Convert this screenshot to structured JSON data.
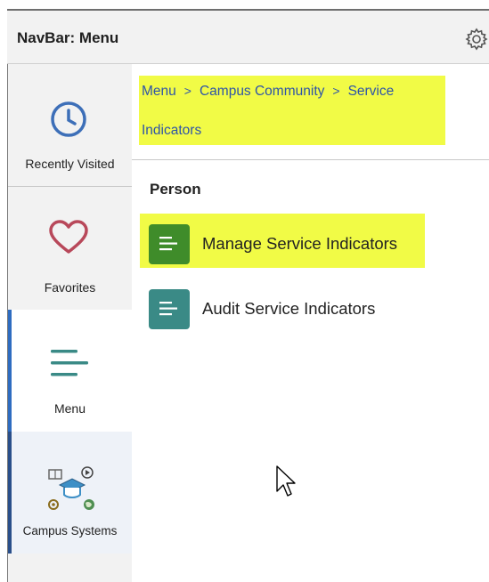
{
  "header": {
    "title": "NavBar: Menu",
    "gear_icon": "gear-icon"
  },
  "sidebar": {
    "items": [
      {
        "label": "Recently Visited",
        "icon": "clock-icon"
      },
      {
        "label": "Favorites",
        "icon": "heart-icon"
      },
      {
        "label": "Menu",
        "icon": "menu-icon"
      },
      {
        "label": "Campus Systems",
        "icon": "campus-systems-icon"
      }
    ]
  },
  "breadcrumb": {
    "items": [
      "Menu",
      "Campus Community",
      "Service",
      "Indicators"
    ],
    "separator": ">"
  },
  "section": {
    "title": "Person"
  },
  "menu_items": [
    {
      "label": "Manage Service Indicators",
      "icon": "list-icon",
      "color": "#3f8c2a"
    },
    {
      "label": "Audit Service Indicators",
      "icon": "list-icon",
      "color": "#3a8a86"
    }
  ],
  "colors": {
    "highlight": "#f1fb46",
    "active_accent": "#2e6cc0",
    "link": "#2e54a8"
  }
}
